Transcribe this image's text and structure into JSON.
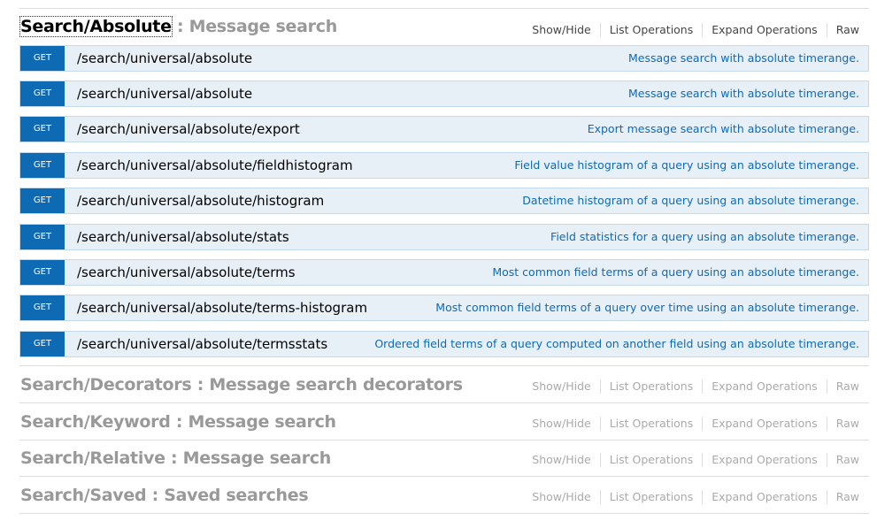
{
  "options": {
    "show_hide": "Show/Hide",
    "list_operations": "List Operations",
    "expand_operations": "Expand Operations",
    "raw": "Raw"
  },
  "resources": [
    {
      "path": "Search/Absolute",
      "separator": " : ",
      "description": "Message search",
      "expanded": true,
      "operations": [
        {
          "method": "GET",
          "path": "/search/universal/absolute",
          "summary": "Message search with absolute timerange."
        },
        {
          "method": "GET",
          "path": "/search/universal/absolute",
          "summary": "Message search with absolute timerange."
        },
        {
          "method": "GET",
          "path": "/search/universal/absolute/export",
          "summary": "Export message search with absolute timerange."
        },
        {
          "method": "GET",
          "path": "/search/universal/absolute/fieldhistogram",
          "summary": "Field value histogram of a query using an absolute timerange."
        },
        {
          "method": "GET",
          "path": "/search/universal/absolute/histogram",
          "summary": "Datetime histogram of a query using an absolute timerange."
        },
        {
          "method": "GET",
          "path": "/search/universal/absolute/stats",
          "summary": "Field statistics for a query using an absolute timerange."
        },
        {
          "method": "GET",
          "path": "/search/universal/absolute/terms",
          "summary": "Most common field terms of a query using an absolute timerange."
        },
        {
          "method": "GET",
          "path": "/search/universal/absolute/terms-histogram",
          "summary": "Most common field terms of a query over time using an absolute timerange."
        },
        {
          "method": "GET",
          "path": "/search/universal/absolute/termsstats",
          "summary": "Ordered field terms of a query computed on another field using an absolute timerange."
        }
      ]
    },
    {
      "path": "Search/Decorators",
      "separator": " : ",
      "description": "Message search decorators",
      "expanded": false
    },
    {
      "path": "Search/Keyword",
      "separator": " : ",
      "description": "Message search",
      "expanded": false
    },
    {
      "path": "Search/Relative",
      "separator": " : ",
      "description": "Message search",
      "expanded": false
    },
    {
      "path": "Search/Saved",
      "separator": " : ",
      "description": "Saved searches",
      "expanded": false
    }
  ],
  "colors": {
    "get_method": "#0f6ab4",
    "op_background": "#e7f0f7",
    "op_border": "#c3d9ec",
    "summary_link": "#0f6ab4",
    "inactive_heading": "#999999"
  }
}
